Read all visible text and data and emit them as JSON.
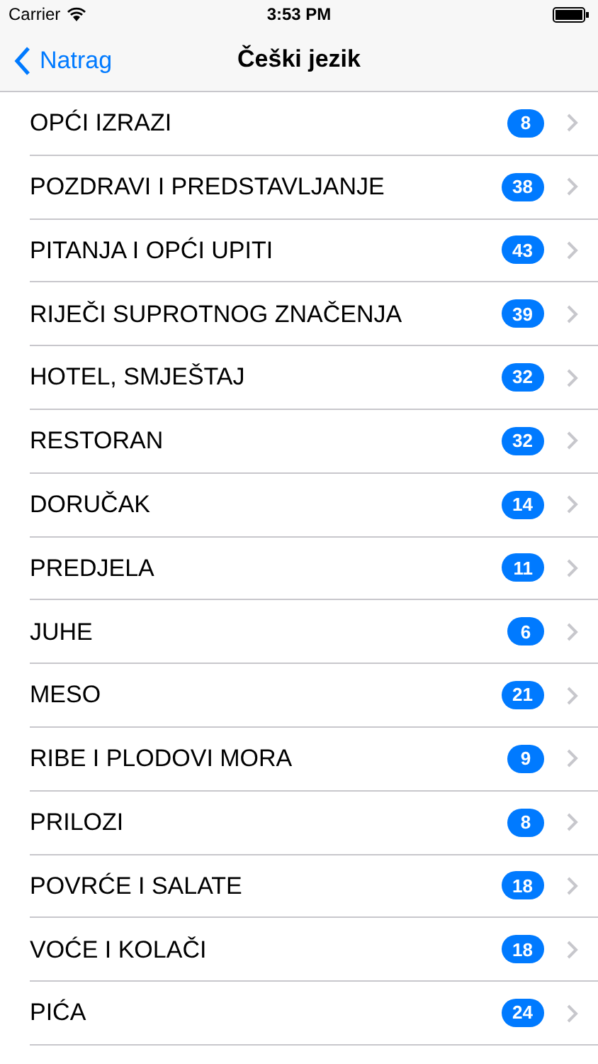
{
  "status_bar": {
    "carrier": "Carrier",
    "time": "3:53 PM"
  },
  "nav": {
    "back": "Natrag",
    "title": "Češki jezik"
  },
  "items": [
    {
      "label": "OPĆI IZRAZI",
      "count": "8"
    },
    {
      "label": "POZDRAVI I PREDSTAVLJANJE",
      "count": "38"
    },
    {
      "label": "PITANJA I OPĆI UPITI",
      "count": "43"
    },
    {
      "label": "RIJEČI SUPROTNOG ZNAČENJA",
      "count": "39"
    },
    {
      "label": "HOTEL, SMJEŠTAJ",
      "count": "32"
    },
    {
      "label": "RESTORAN",
      "count": "32"
    },
    {
      "label": "DORUČAK",
      "count": "14"
    },
    {
      "label": "PREDJELA",
      "count": "11"
    },
    {
      "label": "JUHE",
      "count": "6"
    },
    {
      "label": "MESO",
      "count": "21"
    },
    {
      "label": "RIBE I PLODOVI MORA",
      "count": "9"
    },
    {
      "label": "PRILOZI",
      "count": "8"
    },
    {
      "label": "POVRĆE I SALATE",
      "count": "18"
    },
    {
      "label": "VOĆE I KOLAČI",
      "count": "18"
    },
    {
      "label": "PIĆA",
      "count": "24"
    }
  ]
}
